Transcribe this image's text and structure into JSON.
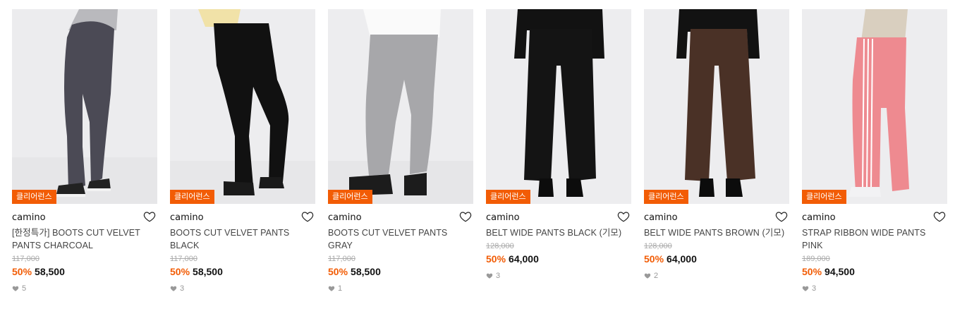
{
  "colors": {
    "accent": "#f25c05",
    "badge_bg": "#f25c05",
    "strike": "#aaaaaa"
  },
  "products": [
    {
      "badge": "클리어런스",
      "brand": "camino",
      "name": "[한정특가] BOOTS CUT VELVET PANTS CHARCOAL",
      "original_price": "117,000",
      "discount": "50%",
      "price": "58,500",
      "likes": "5",
      "pants_color": "#4b4a55",
      "icon": "heart-outline-icon"
    },
    {
      "badge": "클리어런스",
      "brand": "camino",
      "name": "BOOTS CUT VELVET PANTS BLACK",
      "original_price": "117,000",
      "discount": "50%",
      "price": "58,500",
      "likes": "3",
      "pants_color": "#111111",
      "icon": "heart-outline-icon"
    },
    {
      "badge": "클리어런스",
      "brand": "camino",
      "name": "BOOTS CUT VELVET PANTS GRAY",
      "original_price": "117,000",
      "discount": "50%",
      "price": "58,500",
      "likes": "1",
      "pants_color": "#a7a7aa",
      "icon": "heart-outline-icon"
    },
    {
      "badge": "클리어런스",
      "brand": "camino",
      "name": "BELT WIDE PANTS BLACK (기모)",
      "original_price": "128,000",
      "discount": "50%",
      "price": "64,000",
      "likes": "3",
      "pants_color": "#141414",
      "icon": "heart-outline-icon"
    },
    {
      "badge": "클리어런스",
      "brand": "camino",
      "name": "BELT WIDE PANTS BROWN (기모)",
      "original_price": "128,000",
      "discount": "50%",
      "price": "64,000",
      "likes": "2",
      "pants_color": "#4a3126",
      "icon": "heart-outline-icon"
    },
    {
      "badge": "클리어런스",
      "brand": "camino",
      "name": "STRAP RIBBON WIDE PANTS PINK",
      "original_price": "189,000",
      "discount": "50%",
      "price": "94,500",
      "likes": "3",
      "pants_color": "#ee8a90",
      "icon": "heart-outline-icon"
    }
  ]
}
